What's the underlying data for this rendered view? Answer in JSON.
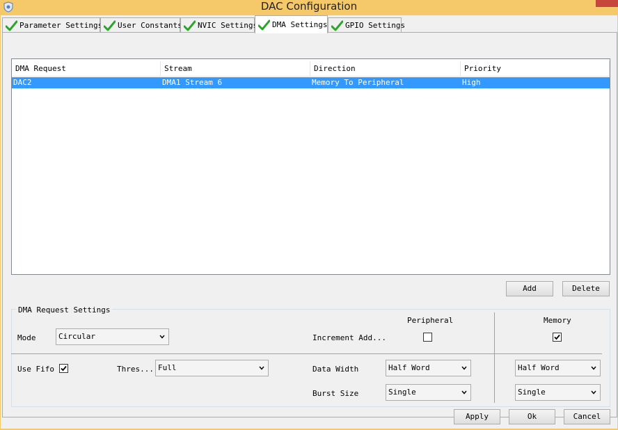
{
  "window": {
    "title": "DAC Configuration"
  },
  "tabs": [
    {
      "label": "Parameter Settings"
    },
    {
      "label": "User Constants"
    },
    {
      "label": "NVIC Settings"
    },
    {
      "label": "DMA Settings"
    },
    {
      "label": "GPIO Settings"
    }
  ],
  "table": {
    "columns": [
      "DMA Request",
      "Stream",
      "Direction",
      "Priority"
    ],
    "rows": [
      [
        "DAC2",
        "DMA1 Stream 6",
        "Memory To Peripheral",
        "High"
      ]
    ]
  },
  "table_buttons": {
    "add": "Add",
    "delete": "Delete"
  },
  "settings": {
    "title": "DMA Request Settings",
    "mode_label": "Mode",
    "mode_value": "Circular",
    "peripheral_header": "Peripheral",
    "memory_header": "Memory",
    "increment_label": "Increment Add...",
    "peripheral_increment": false,
    "memory_increment": true,
    "use_fifo_label": "Use Fifo",
    "use_fifo": true,
    "threshold_label": "Thres...",
    "threshold_value": "Full",
    "data_width_label": "Data Width",
    "peripheral_data_width": "Half Word",
    "memory_data_width": "Half Word",
    "burst_size_label": "Burst Size",
    "peripheral_burst_size": "Single",
    "memory_burst_size": "Single"
  },
  "footer": {
    "apply": "Apply",
    "ok": "Ok",
    "cancel": "Cancel"
  },
  "colors": {
    "frame": "#f5c869",
    "selection": "#3399ff",
    "close": "#c7463b"
  }
}
